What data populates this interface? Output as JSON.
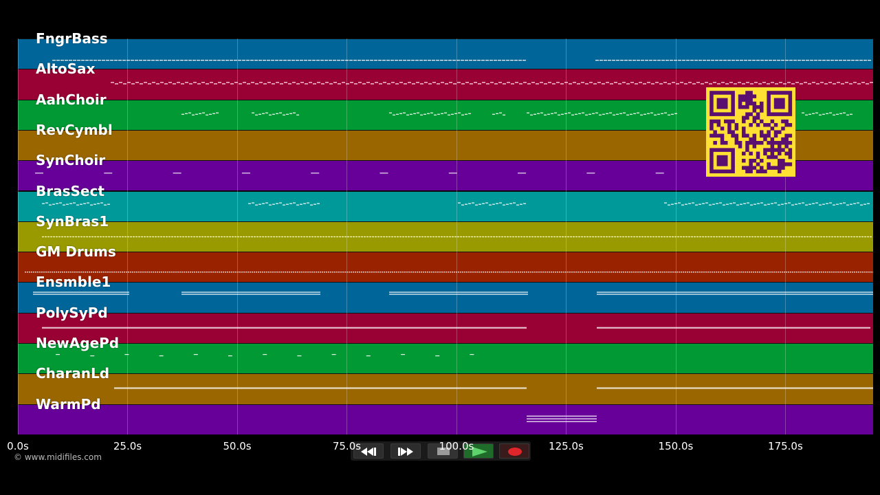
{
  "tracks": [
    {
      "name": "FngrBass",
      "color": "#006699"
    },
    {
      "name": "AltoSax",
      "color": "#990033"
    },
    {
      "name": "AahChoir",
      "color": "#009933"
    },
    {
      "name": "RevCymbl",
      "color": "#996600"
    },
    {
      "name": "SynChoir",
      "color": "#660099"
    },
    {
      "name": "BrasSect",
      "color": "#009999"
    },
    {
      "name": "SynBras1",
      "color": "#999900"
    },
    {
      "name": "GM Drums",
      "color": "#992200"
    },
    {
      "name": "Ensmble1",
      "color": "#006699"
    },
    {
      "name": "PolySyPd",
      "color": "#990033"
    },
    {
      "name": "NewAgePd",
      "color": "#009933"
    },
    {
      "name": "CharanLd",
      "color": "#996600"
    },
    {
      "name": "WarmPd",
      "color": "#660099"
    }
  ],
  "timeline": {
    "ticks": [
      "0.0s",
      "25.0s",
      "50.0s",
      "75.0s",
      "100.0s",
      "125.0s",
      "150.0s",
      "175.0s"
    ],
    "max_seconds": 195
  },
  "copyright": "© www.midifiles.com",
  "transport": {
    "buttons": [
      "rewind",
      "fast-forward",
      "stop",
      "play",
      "record"
    ]
  },
  "qr_color": "#ffe033",
  "qr_dark": "#5a1070"
}
